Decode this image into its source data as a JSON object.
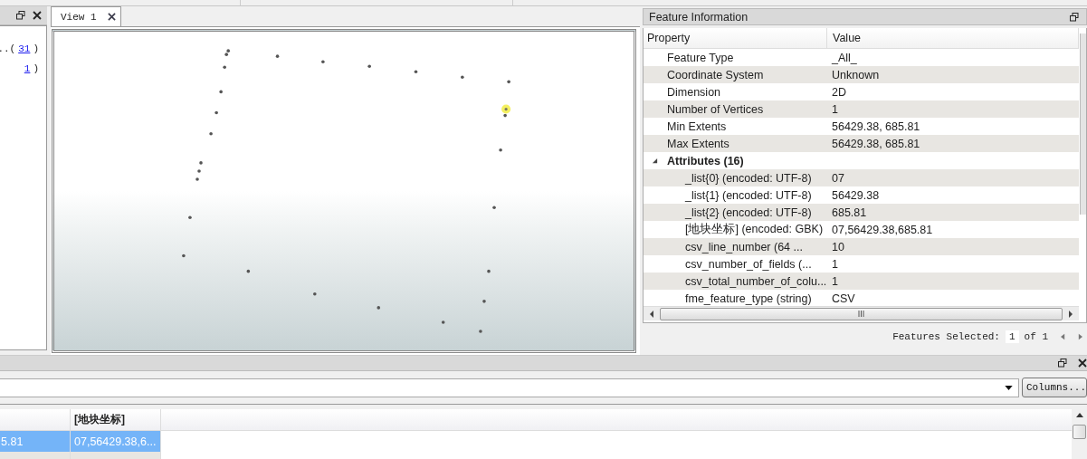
{
  "left_panel": {
    "lines": [
      {
        "prefix": "..(",
        "link": "31",
        "suffix": ")"
      },
      {
        "link": "1",
        "suffix": ")"
      }
    ]
  },
  "view_tabs": [
    {
      "label": "View 1",
      "selected": true
    }
  ],
  "feature_info": {
    "title": "Feature Information",
    "columns": [
      "Property",
      "Value"
    ],
    "rows": [
      {
        "property": "Feature Type",
        "value": "_All_"
      },
      {
        "property": "Coordinate System",
        "value": "Unknown"
      },
      {
        "property": "Dimension",
        "value": "2D"
      },
      {
        "property": "Number of Vertices",
        "value": "1"
      },
      {
        "property": "Min Extents",
        "value": "56429.38, 685.81"
      },
      {
        "property": "Max Extents",
        "value": "56429.38, 685.81"
      },
      {
        "property": "Attributes (16)",
        "kind": "group",
        "expanded": true,
        "children": [
          {
            "property": "_list{0} (encoded: UTF-8)",
            "value": "07"
          },
          {
            "property": "_list{1} (encoded: UTF-8)",
            "value": "56429.38"
          },
          {
            "property": "_list{2} (encoded: UTF-8)",
            "value": "685.81"
          },
          {
            "property": "[地块坐标] (encoded: GBK)",
            "value": "07,56429.38,685.81"
          },
          {
            "property": "csv_line_number (64 ...",
            "value": "10"
          },
          {
            "property": "csv_number_of_fields (...",
            "value": "1"
          },
          {
            "property": "csv_total_number_of_colu...",
            "value": "1"
          },
          {
            "property": "fme_feature_type (string)",
            "value": "CSV"
          }
        ]
      }
    ],
    "features_selected": {
      "label": "Features Selected:",
      "value": "1",
      "total": "of 1"
    }
  },
  "table_panel": {
    "columns_button": "Columns...",
    "columns": [
      null,
      {
        "label": "[地块坐标]"
      }
    ],
    "rows": [
      {
        "selected": true,
        "cells": [
          "5.81",
          "07,56429.38,6..."
        ]
      }
    ]
  }
}
